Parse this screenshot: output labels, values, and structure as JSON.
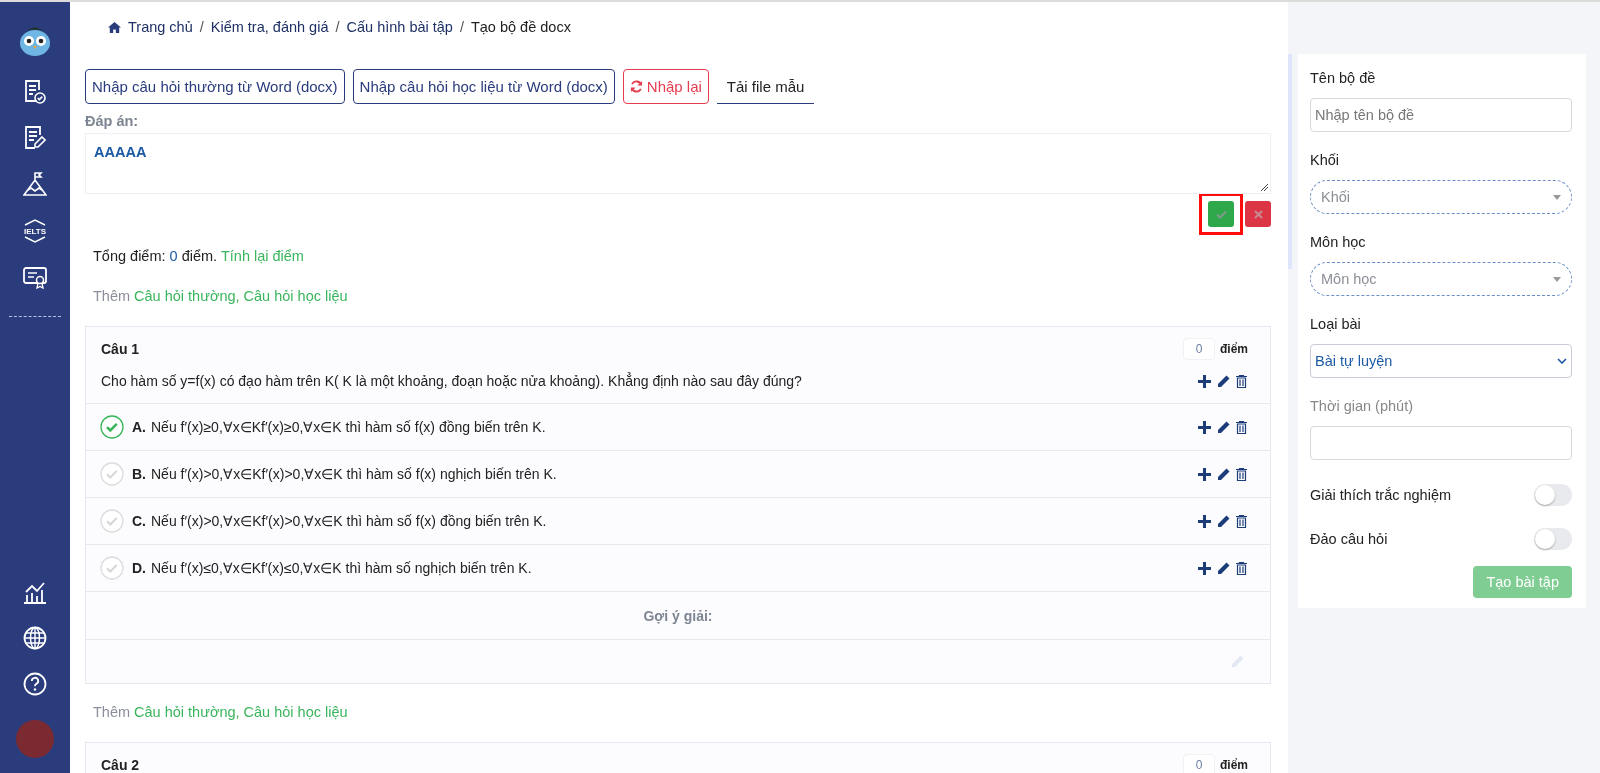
{
  "sidebar": {
    "badge_text": "IELTS"
  },
  "breadcrumb_separator": "/",
  "breadcrumb": [
    {
      "label": "Trang chủ",
      "kind": "home"
    },
    {
      "label": "Kiểm tra, đánh giá",
      "kind": "link"
    },
    {
      "label": "Cấu hình bài tập",
      "kind": "link"
    },
    {
      "label": "Tạo bộ đề docx",
      "kind": "current"
    }
  ],
  "toolbar": [
    {
      "label": "Nhập câu hỏi thường từ Word (docx)",
      "kind": "outline"
    },
    {
      "label": "Nhập câu hỏi học liệu từ Word (docx)",
      "kind": "outline"
    },
    {
      "label": "Nhập lại",
      "kind": "danger"
    },
    {
      "label": "Tải file mẫu",
      "kind": "tab"
    }
  ],
  "answer": {
    "label": "Đáp án:",
    "value": "AAAAA",
    "confirm_highlighted": true
  },
  "total": {
    "prefix": "Tổng điểm:",
    "score": "0",
    "suffix": "điểm.",
    "action": "Tính lại điểm"
  },
  "blocks": [
    {
      "kind": "add",
      "prefix": "Thêm",
      "links": [
        "Câu hỏi thường",
        "Câu hỏi học liệu"
      ],
      "separator": ","
    },
    {
      "kind": "question",
      "title": "Câu 1",
      "points": "0",
      "points_unit": "điểm",
      "text": "Cho hàm số y=f(x) có đạo hàm trên K( K là một khoảng, đoạn hoặc nửa khoảng). Khẳng định nào sau đây đúng?",
      "options": [
        {
          "letter": "A.",
          "text": "Nếu f′(x)≥0,∀x∈Kf′(x)≥0,∀x∈K thì hàm số f(x) đồng biến trên K.",
          "correct": true
        },
        {
          "letter": "B.",
          "text": "Nếu f′(x)>0,∀x∈Kf′(x)>0,∀x∈K thì hàm số f(x) nghịch biến trên K.",
          "correct": false
        },
        {
          "letter": "C.",
          "text": "Nếu f′(x)>0,∀x∈Kf′(x)>0,∀x∈K thì hàm số f(x) đồng biến trên K.",
          "correct": false
        },
        {
          "letter": "D.",
          "text": "Nếu f′(x)≤0,∀x∈Kf′(x)≤0,∀x∈K thì hàm số nghịch biến trên K.",
          "correct": false
        }
      ],
      "hint_label": "Gợi ý giải:"
    },
    {
      "kind": "add",
      "prefix": "Thêm",
      "links": [
        "Câu hỏi thường",
        "Câu hỏi học liệu"
      ],
      "separator": ","
    },
    {
      "kind": "question",
      "title": "Câu 2",
      "points": "0",
      "points_unit": "điểm"
    }
  ],
  "form": {
    "fields": [
      {
        "kind": "text",
        "label": "Tên bộ đề",
        "placeholder": "Nhập tên bộ đề"
      },
      {
        "kind": "dropdown",
        "label": "Khối",
        "placeholder": "Khối"
      },
      {
        "kind": "dropdown",
        "label": "Môn học",
        "placeholder": "Môn học"
      },
      {
        "kind": "select",
        "label": "Loại bài",
        "value": "Bài tự luyện"
      },
      {
        "kind": "text",
        "label": "Thời gian (phút)",
        "disabled": true
      },
      {
        "kind": "toggle",
        "label": "Giải thích trắc nghiệm",
        "on": false
      },
      {
        "kind": "toggle",
        "label": "Đảo câu hỏi",
        "on": false
      }
    ],
    "submit": {
      "label": "Tạo bài tập",
      "disabled": true
    }
  }
}
